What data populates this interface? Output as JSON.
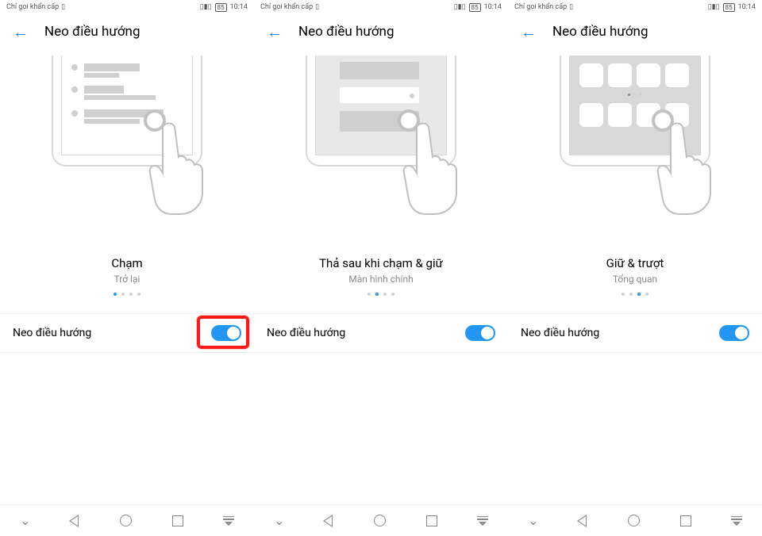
{
  "status": {
    "left_text": "Chỉ gọi khẩn cấp",
    "battery": "85",
    "time": "10:14"
  },
  "header": {
    "title": "Neo điều hướng"
  },
  "screens": [
    {
      "caption_title": "Chạm",
      "caption_sub": "Trở lại",
      "active_page": 0,
      "setting_label": "Neo điều hướng",
      "highlighted": true
    },
    {
      "caption_title": "Thả sau khi chạm & giữ",
      "caption_sub": "Màn hình chính",
      "active_page": 1,
      "setting_label": "Neo điều hướng",
      "highlighted": false
    },
    {
      "caption_title": "Giữ & trượt",
      "caption_sub": "Tổng quan",
      "active_page": 2,
      "setting_label": "Neo điều hướng",
      "highlighted": false
    }
  ],
  "pager_count": 4
}
